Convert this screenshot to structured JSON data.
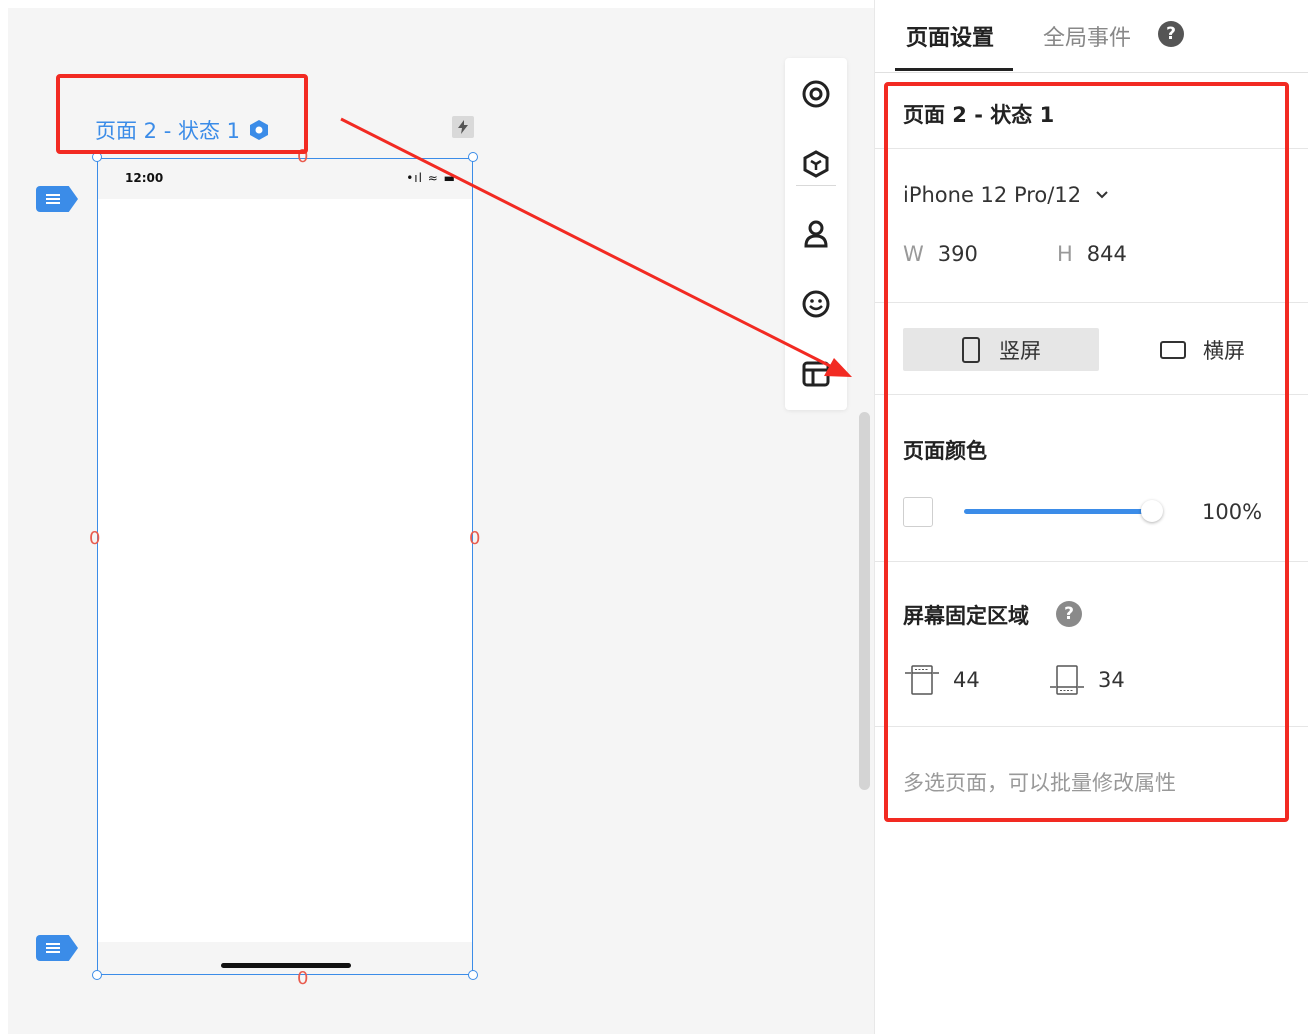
{
  "canvas": {
    "page_label": "页面 2 - 状态 1",
    "status_time": "12:00",
    "status_signal": "•ıl ≈ ▬",
    "margin_marks": [
      "0",
      "0",
      "0",
      "0"
    ]
  },
  "toolbar": {
    "tools": [
      "target-icon",
      "component-cube-icon",
      "user-icon",
      "smiley-icon",
      "layout-icon"
    ]
  },
  "panel": {
    "tabs": {
      "active": "页面设置",
      "inactive": "全局事件",
      "help": "?"
    },
    "page_name": "页面 2 - 状态 1",
    "device": "iPhone 12 Pro/12",
    "width_label": "W",
    "width_value": "390",
    "height_label": "H",
    "height_value": "844",
    "portrait_label": "竖屏",
    "landscape_label": "横屏",
    "page_color_title": "页面颜色",
    "opacity_value": "100%",
    "opacity_level": 1.0,
    "fixed_area_title": "屏幕固定区域",
    "fixed_area_help": "?",
    "top_fixed": "44",
    "bottom_fixed": "34",
    "hint": "多选页面，可以批量修改属性"
  },
  "colors": {
    "accent": "#3b8ce8",
    "annotation_red": "#f22a22"
  }
}
